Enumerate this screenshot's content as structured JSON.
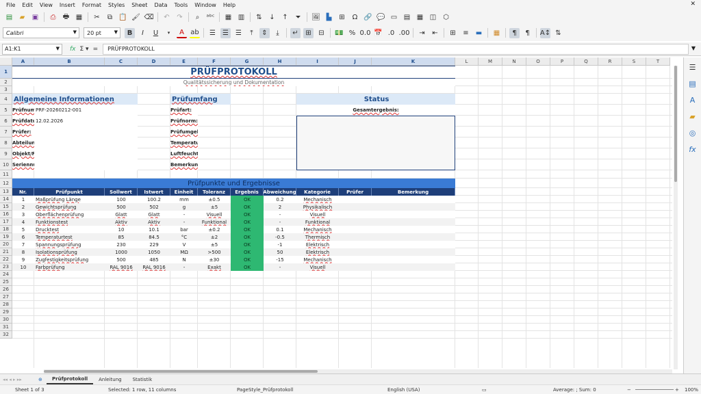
{
  "menu": [
    "File",
    "Edit",
    "View",
    "Insert",
    "Format",
    "Styles",
    "Sheet",
    "Data",
    "Tools",
    "Window",
    "Help"
  ],
  "font": {
    "name": "Calibri",
    "size": "20 pt"
  },
  "namebox": "A1:K1",
  "formula": "PRÜFPROTOKOLL",
  "columns": [
    "A",
    "B",
    "C",
    "D",
    "E",
    "F",
    "G",
    "H",
    "I",
    "J",
    "K",
    "L",
    "M",
    "N",
    "O",
    "P",
    "Q",
    "R",
    "S",
    "T"
  ],
  "rows": [
    "1",
    "2",
    "3",
    "4",
    "5",
    "6",
    "7",
    "8",
    "9",
    "10",
    "11",
    "12",
    "13",
    "14",
    "15",
    "16",
    "17",
    "18",
    "19",
    "20",
    "21",
    "22",
    "23",
    "24",
    "25",
    "26",
    "27",
    "28",
    "29",
    "30",
    "31",
    "32"
  ],
  "sheet": {
    "title": "PRÜFPROTOKOLL",
    "subtitle": "Qualitätssicherung und Dokumentation",
    "general_header": "Allgemeine Informationen",
    "scope_header": "Prüfumfang",
    "status_header": "Status",
    "overall_label": "Gesamtergebnis:",
    "general": [
      {
        "label": "Prüfnummer:",
        "value": "PRF-20260212-001"
      },
      {
        "label": "Prüfdatum:",
        "value": "12.02.2026"
      },
      {
        "label": "Prüfer:",
        "value": ""
      },
      {
        "label": "Abteilung:",
        "value": ""
      },
      {
        "label": "Objekt/Produkt:",
        "value": ""
      },
      {
        "label": "Seriennummer:",
        "value": ""
      }
    ],
    "scope": [
      "Prüfart:",
      "Prüfnorm:",
      "Prüfumgebung:",
      "Temperatur:",
      "Luftfeuchtigkeit:",
      "Bemerkungen:"
    ],
    "results_banner": "Prüfpunkte und Ergebnisse",
    "table_headers": [
      "Nr.",
      "Prüfpunkt",
      "Sollwert",
      "Istwert",
      "Einheit",
      "Toleranz",
      "Ergebnis",
      "Abweichung",
      "Kategorie",
      "Prüfer",
      "Bemerkung"
    ],
    "table_rows": [
      [
        "1",
        "Maßprüfung Länge",
        "100",
        "100.2",
        "mm",
        "±0.5",
        "OK",
        "0.2",
        "Mechanisch"
      ],
      [
        "2",
        "Gewichtsprüfung",
        "500",
        "502",
        "g",
        "±5",
        "OK",
        "2",
        "Physikalisch"
      ],
      [
        "3",
        "Oberflächenprüfung",
        "Glatt",
        "Glatt",
        "-",
        "Visuell",
        "OK",
        "-",
        "Visuell"
      ],
      [
        "4",
        "Funktionstest",
        "Aktiv",
        "Aktiv",
        "-",
        "Funktional",
        "OK",
        "-",
        "Funktional"
      ],
      [
        "5",
        "Drucktest",
        "10",
        "10.1",
        "bar",
        "±0.2",
        "OK",
        "0.1",
        "Mechanisch"
      ],
      [
        "6",
        "Temperaturtest",
        "85",
        "84.5",
        "°C",
        "±2",
        "OK",
        "-0.5",
        "Thermisch"
      ],
      [
        "7",
        "Spannungsprüfung",
        "230",
        "229",
        "V",
        "±5",
        "OK",
        "-1",
        "Elektrisch"
      ],
      [
        "8",
        "Isolationsprüfung",
        "1000",
        "1050",
        "MΩ",
        ">500",
        "OK",
        "50",
        "Elektrisch"
      ],
      [
        "9",
        "Zugfestigkeitsprüfung",
        "500",
        "485",
        "N",
        "±30",
        "OK",
        "-15",
        "Mechanisch"
      ],
      [
        "10",
        "Farbprüfung",
        "RAL 9016",
        "RAL 9016",
        "-",
        "Exakt",
        "OK",
        "-",
        "Visuell"
      ]
    ]
  },
  "tabs": [
    "Prüfprotokoll",
    "Anleitung",
    "Statistik"
  ],
  "status": {
    "sheet": "Sheet 1 of 3",
    "selection": "Selected: 1 row, 11 columns",
    "pagestyle": "PageStyle_Prüfprotokoll",
    "language": "English (USA)",
    "sum": "Average: ; Sum: 0",
    "zoom": "100%"
  }
}
